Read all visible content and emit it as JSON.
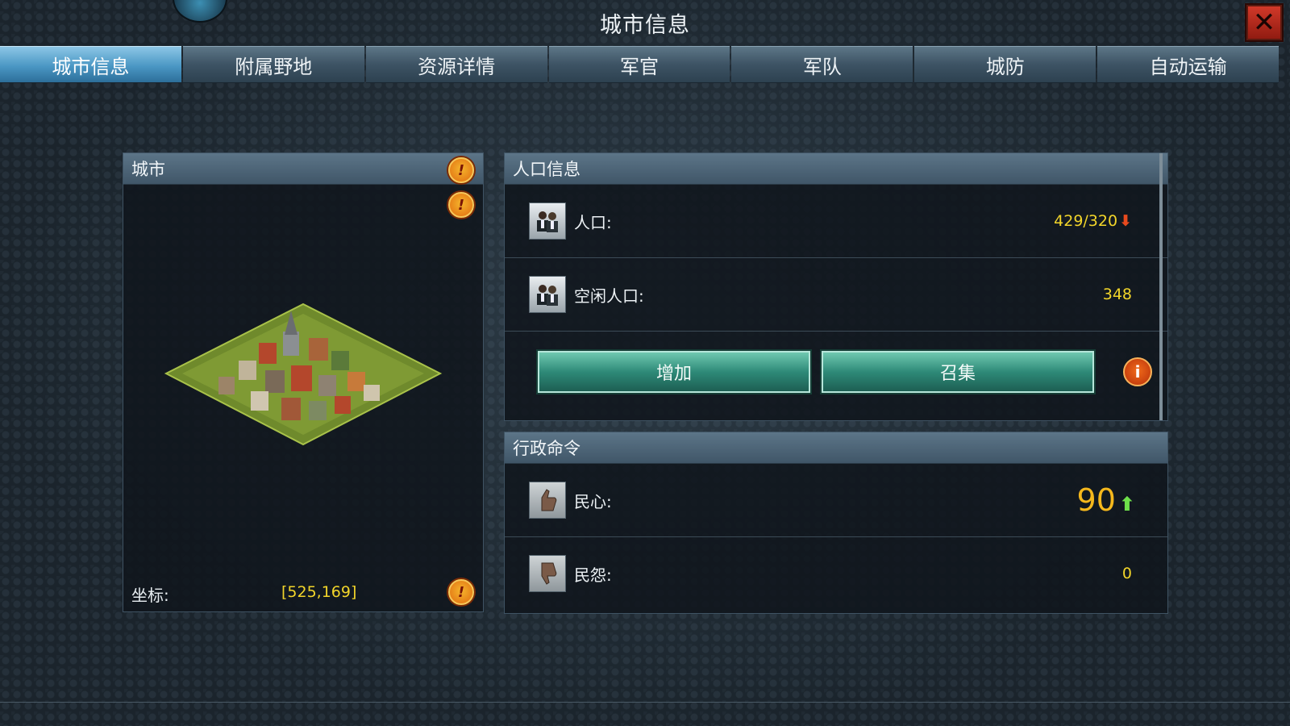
{
  "window": {
    "title": "城市信息"
  },
  "tabs": [
    "城市信息",
    "附属野地",
    "资源详情",
    "军官",
    "军队",
    "城防",
    "自动运输"
  ],
  "city_panel": {
    "header": "城市",
    "coordinates_label": "坐标:",
    "coordinates_value": "[525,169]"
  },
  "population_panel": {
    "header": "人口信息",
    "population_label": "人口:",
    "population_value": "429/320",
    "idle_label": "空闲人口:",
    "idle_value": "348",
    "add_button": "增加",
    "gather_button": "召集"
  },
  "admin_panel": {
    "header": "行政命令",
    "morale_label": "民心:",
    "morale_value": "90",
    "resentment_label": "民怨:",
    "resentment_value": "0"
  },
  "colors": {
    "accent_yellow": "#f2d52a",
    "tab_active": "#4a97c4",
    "button_green": "#2e8a78"
  }
}
